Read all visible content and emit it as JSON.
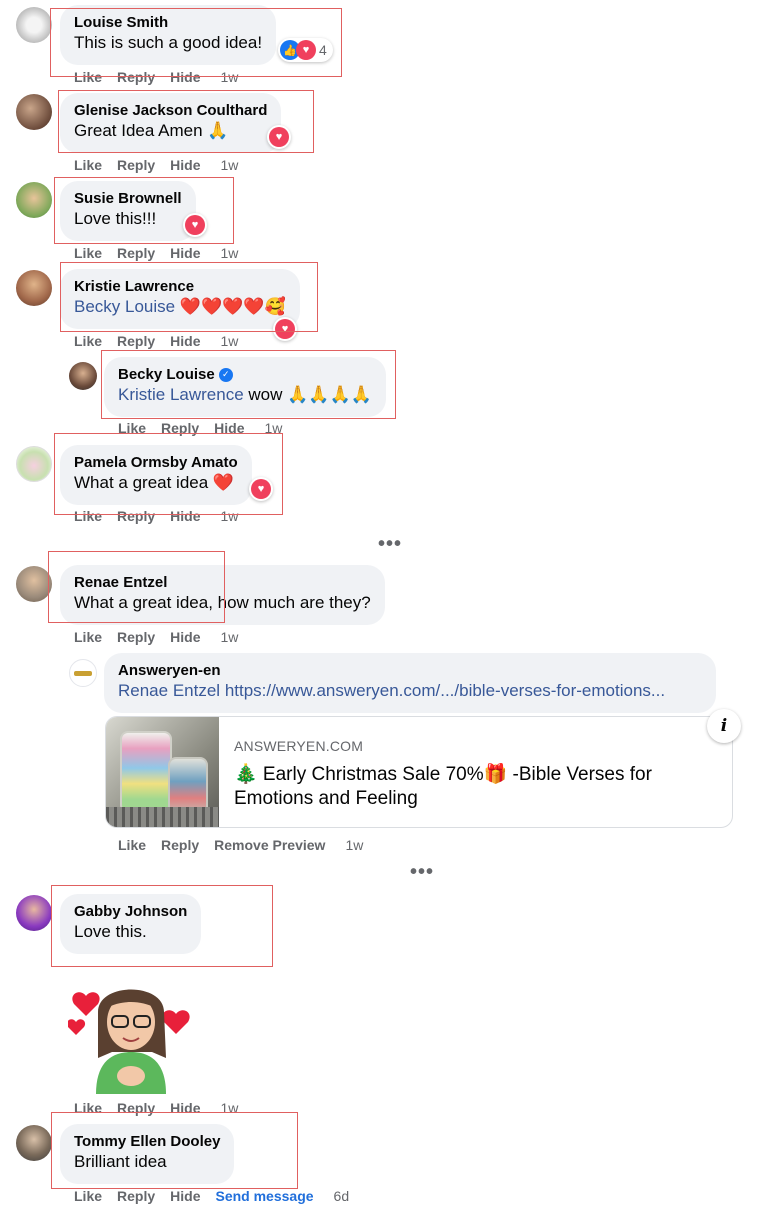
{
  "action_labels": {
    "like": "Like",
    "reply": "Reply",
    "hide": "Hide",
    "remove_preview": "Remove Preview",
    "send_message": "Send message"
  },
  "comments": [
    {
      "author": "Louise Smith",
      "text": "This is such a good idea!",
      "reaction_count": "4",
      "time": "1w"
    },
    {
      "author": "Glenise Jackson Coulthard",
      "text": "Great Idea Amen 🙏",
      "time": "1w"
    },
    {
      "author": "Susie Brownell",
      "text": "Love this!!!",
      "time": "1w"
    },
    {
      "author": "Kristie Lawrence",
      "mention": "Becky Louise",
      "text": " ❤️❤️❤️❤️🥰",
      "time": "1w"
    },
    {
      "author": "Becky Louise",
      "mention": "Kristie Lawrence",
      "text": " wow 🙏🙏🙏🙏",
      "time": "1w"
    },
    {
      "author": "Pamela Ormsby Amato",
      "text": "What a great idea ❤️",
      "time": "1w"
    },
    {
      "author": "Renae Entzel",
      "text": "What a great idea, how much are they?",
      "time": "1w"
    },
    {
      "author": "Answeryen-en",
      "mention": "Renae Entzel",
      "link": "https://www.answeryen.com/.../bible-verses-for-emotions...",
      "time": "1w"
    },
    {
      "author": "Gabby Johnson",
      "text": "Love this.",
      "time": "1w"
    },
    {
      "author": "Tommy Ellen Dooley",
      "text": "Brilliant idea",
      "time": "6d"
    }
  ],
  "link_preview": {
    "domain": "ANSWERYEN.COM",
    "title": "🎄 Early Christmas Sale 70%🎁 -Bible Verses for Emotions and Feeling"
  },
  "more_glyph": "•••",
  "info_glyph": "i",
  "colors": {
    "bubble": "#f0f2f5",
    "meta": "#65676b",
    "link": "#385898",
    "highlight_box": "#e06060",
    "love": "#f0405d",
    "like": "#1877f2"
  }
}
